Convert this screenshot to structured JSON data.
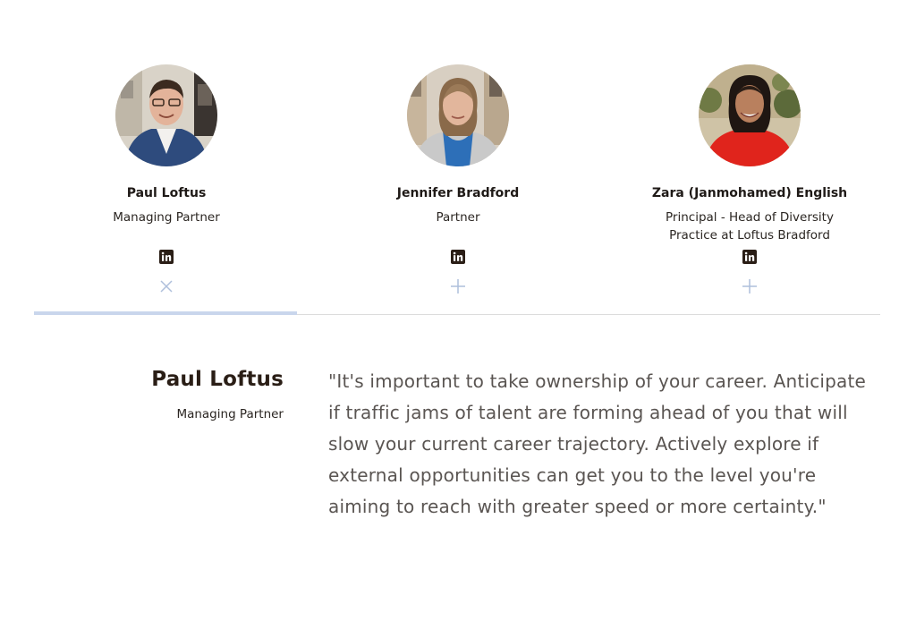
{
  "team": [
    {
      "name": "Paul Loftus",
      "role": "Managing Partner",
      "linkedin_icon": "linkedin-icon",
      "toggle_icon": "close-icon",
      "expanded": true
    },
    {
      "name": "Jennifer Bradford",
      "role": "Partner",
      "linkedin_icon": "linkedin-icon",
      "toggle_icon": "plus-icon",
      "expanded": false
    },
    {
      "name": "Zara (Janmohamed) English",
      "role": "Principal - Head of Diversity Practice at Loftus Bradford",
      "linkedin_icon": "linkedin-icon",
      "toggle_icon": "plus-icon",
      "expanded": false
    }
  ],
  "detail": {
    "name": "Paul Loftus",
    "role": "Managing Partner",
    "quote": "\"It's important to take ownership of your career. Anticipate if traffic jams of talent are forming ahead of you that will slow your current career trajectory. Actively explore if external opportunities can get you to the level you're aiming to reach with greater speed or more certainty.\""
  },
  "colors": {
    "accent_bar": "#c9d6ec",
    "toggle_icon": "#aebfdc",
    "quote_text": "#5a5552",
    "name_text": "#1f1a17"
  }
}
